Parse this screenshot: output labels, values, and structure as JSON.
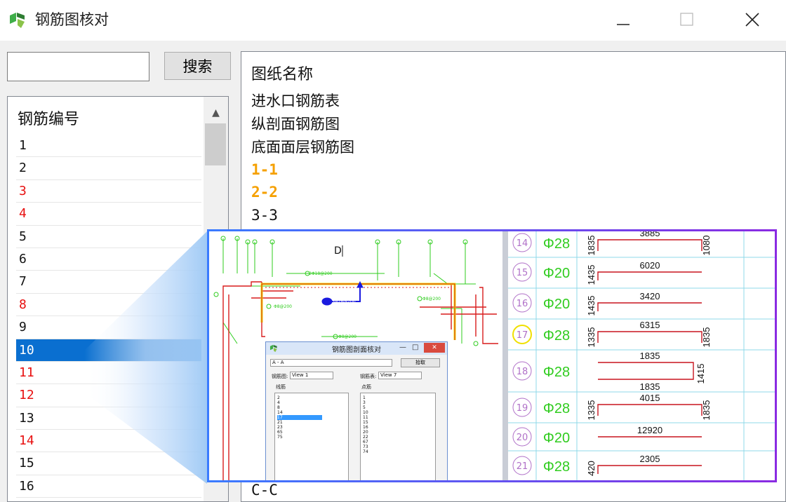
{
  "window": {
    "title": "钢筋图核对",
    "colors": {
      "accent": "#0a6fd0",
      "red_text": "#e81010",
      "orange_text": "#f5a000",
      "cad_green": "#2fcc1e",
      "cad_red": "#d81c1c",
      "cad_yellow": "#f0e000",
      "table_red": "#c8141e",
      "circle_purple": "#b070c8"
    }
  },
  "search": {
    "value": "",
    "button_label": "搜索"
  },
  "rebar_list": {
    "header": "钢筋编号",
    "items": [
      {
        "label": "1",
        "state": "normal"
      },
      {
        "label": "2",
        "state": "normal"
      },
      {
        "label": "3",
        "state": "red"
      },
      {
        "label": "4",
        "state": "red"
      },
      {
        "label": "5",
        "state": "normal"
      },
      {
        "label": "6",
        "state": "normal"
      },
      {
        "label": "7",
        "state": "normal"
      },
      {
        "label": "8",
        "state": "red"
      },
      {
        "label": "9",
        "state": "normal"
      },
      {
        "label": "10",
        "state": "selected"
      },
      {
        "label": "11",
        "state": "red"
      },
      {
        "label": "12",
        "state": "red"
      },
      {
        "label": "13",
        "state": "normal"
      },
      {
        "label": "14",
        "state": "red"
      },
      {
        "label": "15",
        "state": "normal"
      },
      {
        "label": "16",
        "state": "normal"
      }
    ]
  },
  "drawing_list": {
    "header": "图纸名称",
    "items": [
      {
        "label": "进水口钢筋表",
        "state": "normal"
      },
      {
        "label": "纵剖面钢筋图",
        "state": "normal"
      },
      {
        "label": "底面面层钢筋图",
        "state": "normal"
      },
      {
        "label": "1-1",
        "state": "orange"
      },
      {
        "label": "2-2",
        "state": "orange"
      },
      {
        "label": "3-3",
        "state": "normal"
      }
    ],
    "bottom_item": "C-C"
  },
  "preview": {
    "cad_section_mark": "D",
    "cad_labels": [
      "3Φ28@200",
      "2Φ18@200",
      "Φ8@200",
      "Φ8@200",
      "Φ8@200"
    ],
    "dialog": {
      "title": "钢筋图剖面核对",
      "section_select": "A - A",
      "pick_button": "拾取",
      "drawing_label": "钢筋图:",
      "drawing_select": "View 1",
      "table_label": "钢筋表:",
      "table_select": "View 7",
      "line_rebar_label": "线筋",
      "point_rebar_label": "点筋",
      "line_rebars": [
        "2",
        "4",
        "8",
        "14",
        "17",
        "21",
        "23",
        "65",
        "75"
      ],
      "line_rebars_selected": "17",
      "point_rebars": [
        "1",
        "3",
        "5",
        "10",
        "11",
        "15",
        "16",
        "20",
        "22",
        "67",
        "73",
        "74"
      ]
    },
    "rebar_table": [
      {
        "no": "14",
        "dia": "Φ28",
        "top": "3885",
        "left": "1835",
        "right": "1080",
        "bottom": "",
        "shape": "u"
      },
      {
        "no": "15",
        "dia": "Φ20",
        "top": "6020",
        "left": "1435",
        "right": "",
        "bottom": "",
        "shape": "l"
      },
      {
        "no": "16",
        "dia": "Φ20",
        "top": "3420",
        "left": "1435",
        "right": "",
        "bottom": "",
        "shape": "l"
      },
      {
        "no": "17",
        "dia": "Φ28",
        "top": "6315",
        "left": "1335",
        "right": "1835",
        "bottom": "",
        "shape": "u",
        "highlight": true
      },
      {
        "no": "18",
        "dia": "Φ28",
        "top": "1835",
        "left": "",
        "right": "1415",
        "bottom": "1835",
        "shape": "c"
      },
      {
        "no": "19",
        "dia": "Φ28",
        "top": "4015",
        "left": "1335",
        "right": "1835",
        "bottom": "",
        "shape": "u"
      },
      {
        "no": "20",
        "dia": "Φ20",
        "top": "12920",
        "left": "",
        "right": "",
        "bottom": "",
        "shape": "i"
      },
      {
        "no": "21",
        "dia": "Φ28",
        "top": "2305",
        "left": "420",
        "right": "",
        "bottom": "",
        "shape": "l"
      }
    ]
  }
}
